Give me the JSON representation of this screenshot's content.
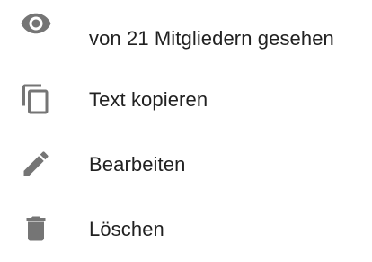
{
  "colors": {
    "text": "#212121",
    "icon": "#757575",
    "background": "#ffffff"
  },
  "menu": {
    "items": [
      {
        "icon": "eye-icon",
        "label": "von 21 Mitgliedern gesehen"
      },
      {
        "icon": "copy-icon",
        "label": "Text kopieren"
      },
      {
        "icon": "pencil-icon",
        "label": "Bearbeiten"
      },
      {
        "icon": "trash-icon",
        "label": "Löschen"
      }
    ]
  }
}
